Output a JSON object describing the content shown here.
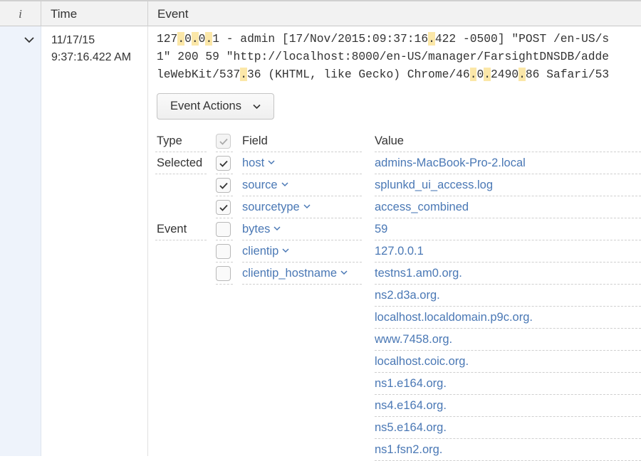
{
  "header": {
    "info": "i",
    "time": "Time",
    "event": "Event"
  },
  "event": {
    "date": "11/17/15",
    "time": "9:37:16.422 AM",
    "raw_lines": [
      [
        {
          "t": "127"
        },
        {
          "t": ".",
          "h": true
        },
        {
          "t": "0"
        },
        {
          "t": ".",
          "h": true
        },
        {
          "t": "0"
        },
        {
          "t": ".",
          "h": true
        },
        {
          "t": "1 - admin [17/Nov/2015:09:37:16"
        },
        {
          "t": ".",
          "h": true
        },
        {
          "t": "422 -0500] \"POST /en-US/s"
        }
      ],
      [
        {
          "t": "1\" 200 59 \"http://localhost:8000/en-US/manager/FarsightDNSDB/adde"
        }
      ],
      [
        {
          "t": "leWebKit/537"
        },
        {
          "t": ".",
          "h": true
        },
        {
          "t": "36 (KHTML, like Gecko) Chrome/46"
        },
        {
          "t": ".",
          "h": true
        },
        {
          "t": "0"
        },
        {
          "t": ".",
          "h": true
        },
        {
          "t": "2490"
        },
        {
          "t": ".",
          "h": true
        },
        {
          "t": "86 Safari/53"
        }
      ]
    ]
  },
  "event_actions": {
    "label": "Event Actions"
  },
  "fields_table": {
    "headers": {
      "type": "Type",
      "field": "Field",
      "value": "Value"
    },
    "rows": [
      {
        "type": "Selected",
        "checked": true,
        "field": "host",
        "value": "admins-MacBook-Pro-2.local"
      },
      {
        "type": "",
        "checked": true,
        "field": "source",
        "value": "splunkd_ui_access.log"
      },
      {
        "type": "",
        "checked": true,
        "field": "sourcetype",
        "value": "access_combined"
      },
      {
        "type": "Event",
        "checked": false,
        "field": "bytes",
        "value": "59"
      },
      {
        "type": "",
        "checked": false,
        "field": "clientip",
        "value": "127.0.0.1"
      },
      {
        "type": "",
        "checked": false,
        "field": "clientip_hostname",
        "value": "testns1.am0.org."
      },
      {
        "type": "",
        "checked": null,
        "field": "",
        "value": "ns2.d3a.org."
      },
      {
        "type": "",
        "checked": null,
        "field": "",
        "value": "localhost.localdomain.p9c.org."
      },
      {
        "type": "",
        "checked": null,
        "field": "",
        "value": "www.7458.org."
      },
      {
        "type": "",
        "checked": null,
        "field": "",
        "value": "localhost.coic.org."
      },
      {
        "type": "",
        "checked": null,
        "field": "",
        "value": "ns1.e164.org."
      },
      {
        "type": "",
        "checked": null,
        "field": "",
        "value": "ns4.e164.org."
      },
      {
        "type": "",
        "checked": null,
        "field": "",
        "value": "ns5.e164.org."
      },
      {
        "type": "",
        "checked": null,
        "field": "",
        "value": "ns1.fsn2.org."
      }
    ]
  },
  "colors": {
    "link": "#4a78b5",
    "highlight": "#fbe7a8",
    "expand_strip": "#eef3fb"
  }
}
